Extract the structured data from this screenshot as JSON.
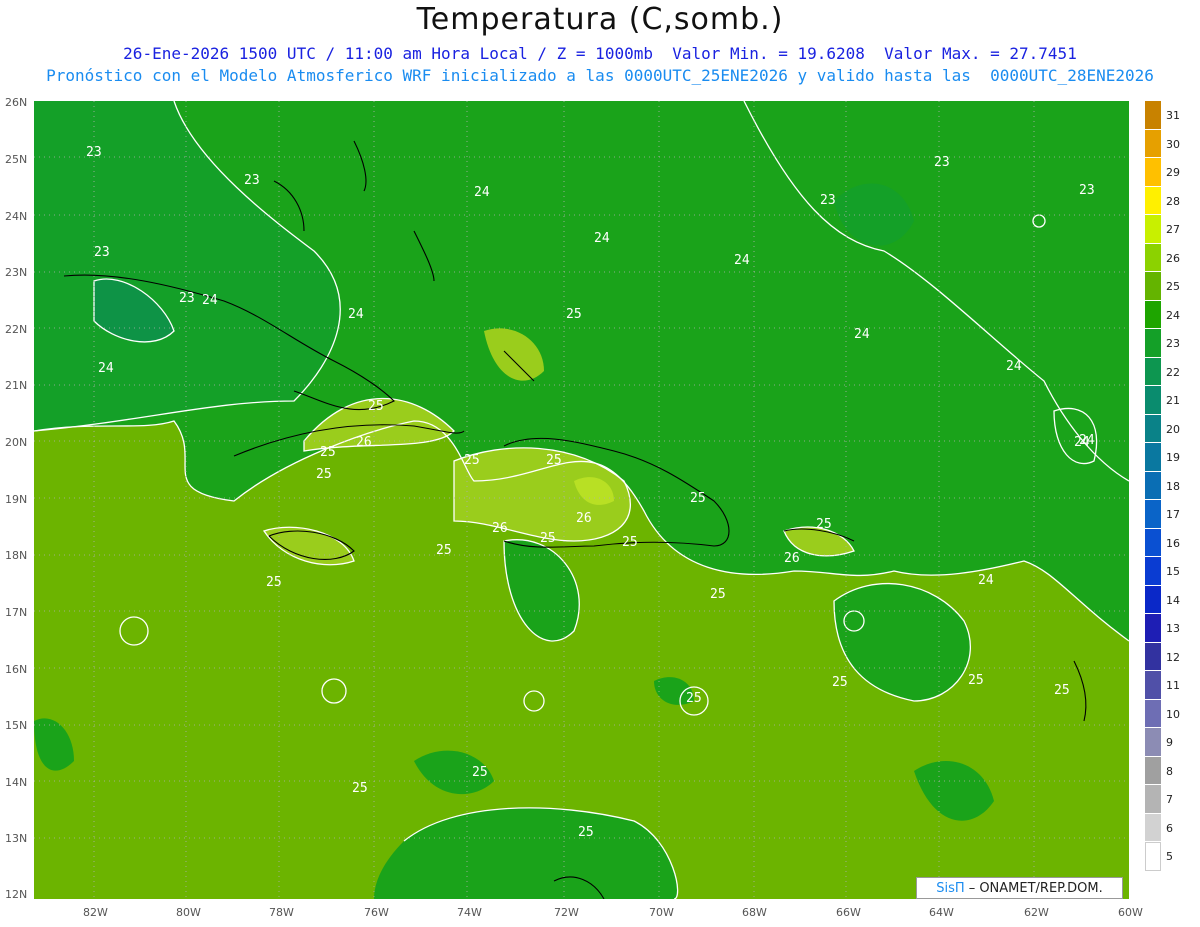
{
  "header": {
    "title": "Temperatura (C,somb.)",
    "line1": "26-Ene-2026 1500 UTC / 11:00 am Hora Local / Z = 1000mb  Valor Min. = 19.6208  Valor Max. = 27.7451",
    "line2": "Pronóstico con el Modelo Atmosferico WRF inicializado a las 0000UTC_25ENE2026 y valido hasta las  0000UTC_28ENE2026"
  },
  "map": {
    "lat_labels": [
      "26N",
      "25N",
      "24N",
      "23N",
      "22N",
      "21N",
      "20N",
      "19N",
      "18N",
      "17N",
      "16N",
      "15N",
      "14N",
      "13N",
      "12N"
    ],
    "lon_labels": [
      "82W",
      "80W",
      "78W",
      "76W",
      "74W",
      "72W",
      "70W",
      "68W",
      "66W",
      "64W",
      "62W",
      "60W"
    ],
    "contour_labels": [
      "23",
      "23",
      "24",
      "23",
      "23",
      "24",
      "23",
      "24",
      "24",
      "24",
      "25",
      "24",
      "24",
      "24",
      "23",
      "23",
      "24",
      "25",
      "26",
      "25",
      "25",
      "25",
      "25",
      "26",
      "25",
      "25",
      "26",
      "25",
      "25",
      "24",
      "24",
      "25",
      "26",
      "25",
      "25",
      "25",
      "25",
      "25",
      "25",
      "25",
      "25",
      "25"
    ],
    "colors": {
      "c23": "#0f9a3a",
      "c24": "#1aa31a",
      "c25": "#6cb400",
      "c26": "#9acd1c",
      "c27": "#b8e024"
    }
  },
  "colorbar": {
    "labels": [
      "31",
      "30",
      "29",
      "28",
      "27",
      "26",
      "25",
      "24",
      "23",
      "22",
      "21",
      "20",
      "19",
      "18",
      "17",
      "16",
      "15",
      "14",
      "13",
      "12",
      "11",
      "10",
      "9",
      "8",
      "7",
      "6",
      "5"
    ],
    "colors": [
      "#c88200",
      "#e6a000",
      "#ffc000",
      "#fff000",
      "#c8f000",
      "#8cd200",
      "#64b400",
      "#1ea500",
      "#14a028",
      "#0d9650",
      "#0a8c6e",
      "#0a8288",
      "#0a78a0",
      "#0a6eb4",
      "#0a64c8",
      "#0a50d2",
      "#0a3cd2",
      "#0a28c8",
      "#1e1eb4",
      "#3232a0",
      "#5050a8",
      "#6e6eb4",
      "#8c8cb4",
      "#a0a0a0",
      "#b4b4b4",
      "#d2d2d2",
      "#ffffff"
    ]
  },
  "credit": {
    "logo": "SisΠ",
    "org": "– ONAMET/REP.DOM."
  }
}
